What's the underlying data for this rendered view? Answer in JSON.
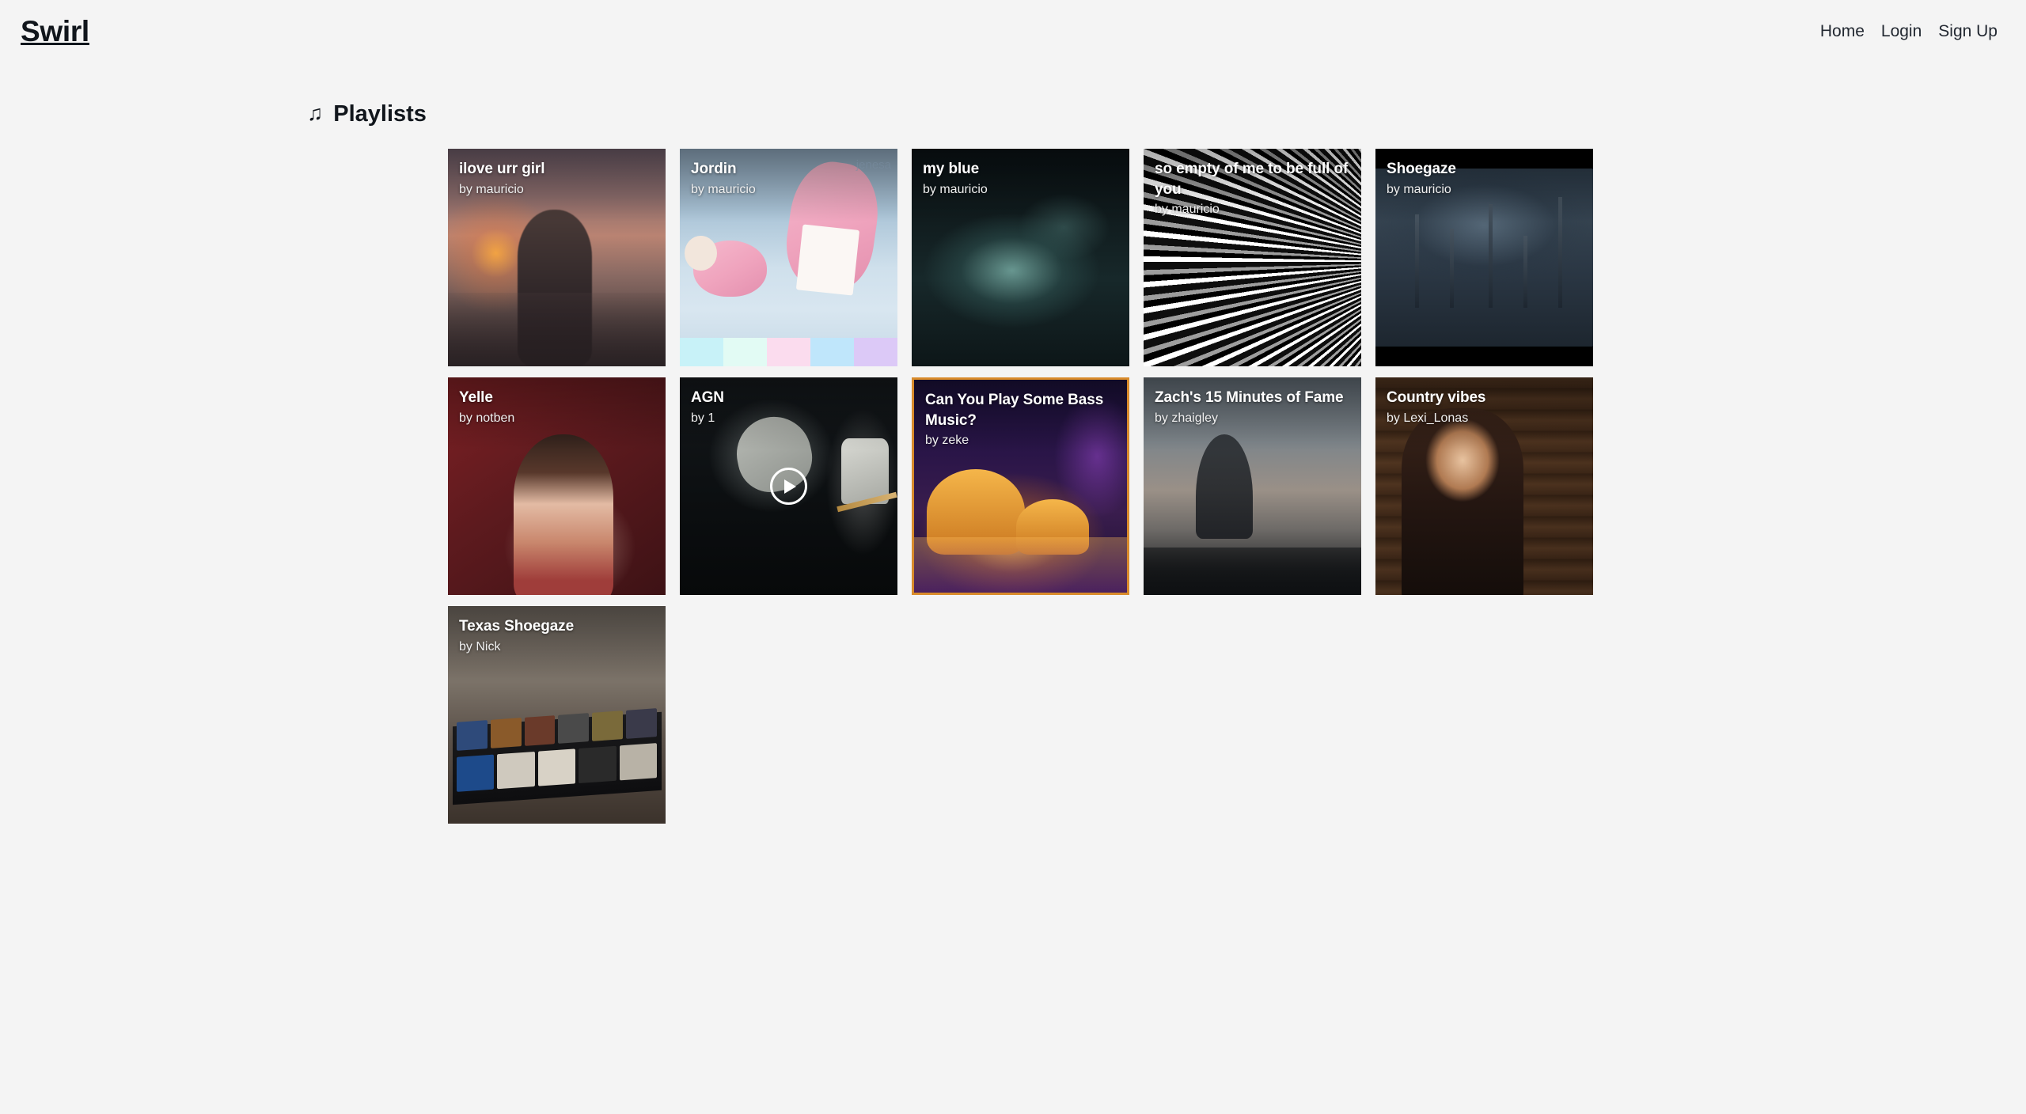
{
  "brand": "Swirl",
  "nav": {
    "links": [
      {
        "label": "Home"
      },
      {
        "label": "Login"
      },
      {
        "label": "Sign Up"
      }
    ]
  },
  "section": {
    "icon": "music-note-icon",
    "icon_glyph": "♫",
    "title": "Playlists"
  },
  "by_prefix": "by ",
  "colors": {
    "page_background": "#f4f4f4",
    "text": "#11161c",
    "card_title": "#ffffff",
    "selected_border": "#d98b2b"
  },
  "playlists": [
    {
      "title": "ilove urr girl",
      "author": "by mauricio",
      "art": "sunset-railway",
      "selected": false,
      "playing": false
    },
    {
      "title": "Jordin",
      "author": "by mauricio",
      "art": "pink-drink",
      "watermark": "jenesa",
      "selected": false,
      "playing": false,
      "swatches": [
        "#c8f2f8",
        "#e2fbf4",
        "#fbdcee",
        "#bfe6fb",
        "#dcc9f7"
      ]
    },
    {
      "title": "my blue",
      "author": "by mauricio",
      "art": "teal-nebula",
      "selected": false,
      "playing": false
    },
    {
      "title": "so empty of me to be full of you",
      "author": "by mauricio",
      "art": "grayscale-swirl",
      "selected": false,
      "playing": false
    },
    {
      "title": "Shoegaze",
      "author": "by mauricio",
      "art": "dark-swamp",
      "selected": false,
      "playing": false
    },
    {
      "title": "Yelle",
      "author": "by notben",
      "art": "red-wall-portrait",
      "selected": false,
      "playing": false
    },
    {
      "title": "AGN",
      "author": "by 1",
      "art": "live-show",
      "selected": false,
      "playing": true
    },
    {
      "title": "Can You Play Some Bass Music?",
      "author": "by zeke",
      "art": "neon-mushrooms",
      "selected": true,
      "playing": false
    },
    {
      "title": "Zach's 15 Minutes of Fame",
      "author": "by zhaigley",
      "art": "hazy-bay",
      "selected": false,
      "playing": false
    },
    {
      "title": "Country vibes",
      "author": "by Lexi_Lonas",
      "art": "wood-portrait",
      "selected": false,
      "playing": false
    },
    {
      "title": "Texas Shoegaze",
      "author": "by Nick",
      "art": "pedalboard",
      "selected": false,
      "playing": false
    }
  ]
}
